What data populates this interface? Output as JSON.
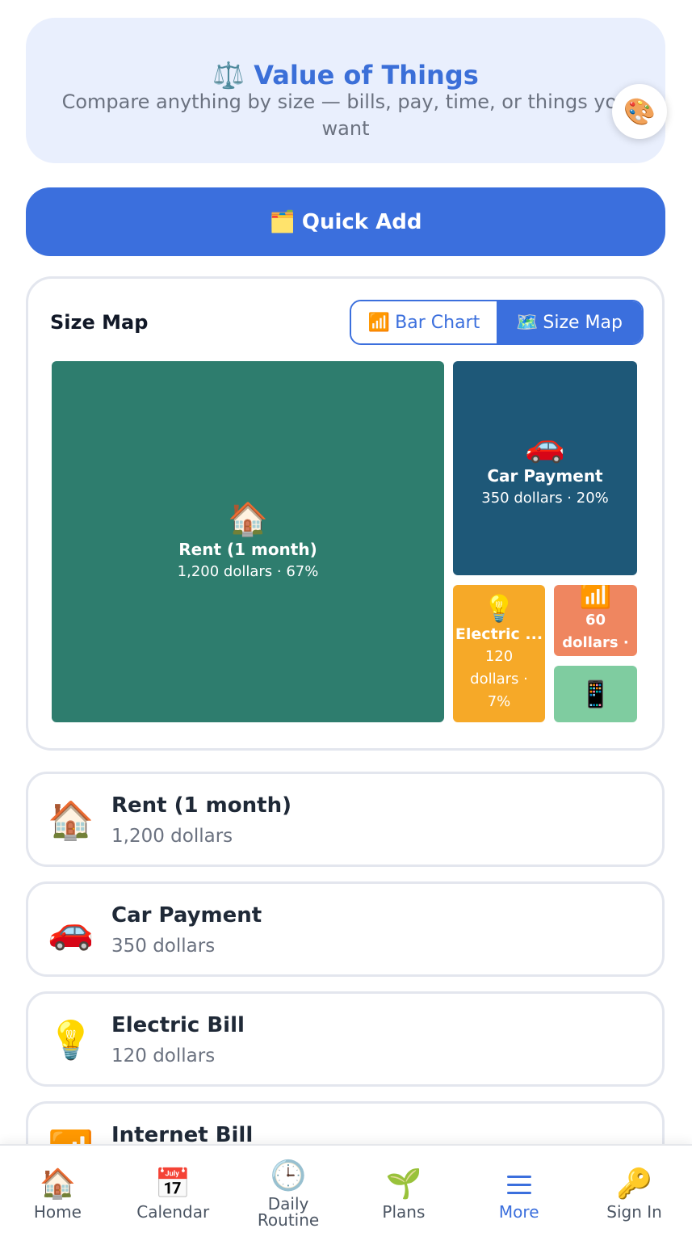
{
  "header": {
    "icon": "⚖️",
    "title": "Value of Things",
    "subtitle": "Compare anything by size — bills, pay, time, or things you want",
    "palette_icon": "🎨"
  },
  "quick_add": {
    "icon": "🗂️",
    "label": "Quick Add"
  },
  "size_map": {
    "title": "Size Map",
    "toggle": [
      {
        "icon": "📶",
        "label": "Bar Chart",
        "active": false
      },
      {
        "icon": "🗺️",
        "label": "Size Map",
        "active": true
      }
    ],
    "tiles": [
      {
        "icon": "🏠",
        "name": "Rent (1 month)",
        "value": "1,200 dollars · 67%",
        "color": "#2e7d6e"
      },
      {
        "icon": "🚗",
        "name": "Car Payment",
        "value": "350 dollars · 20%",
        "color": "#1e5878"
      },
      {
        "icon": "💡",
        "name": "Electric ...",
        "value_lines": [
          "120",
          "dollars ·",
          "7%"
        ],
        "color": "#f6a928"
      },
      {
        "icon": "📶",
        "value_lines": [
          "60",
          "dollars ·"
        ],
        "color": "#ef8660"
      },
      {
        "icon": "📱",
        "color": "#7fcca0"
      }
    ]
  },
  "items": [
    {
      "icon": "🏠",
      "name": "Rent (1 month)",
      "value": "1,200 dollars"
    },
    {
      "icon": "🚗",
      "name": "Car Payment",
      "value": "350 dollars"
    },
    {
      "icon": "💡",
      "name": "Electric Bill",
      "value": "120 dollars"
    },
    {
      "icon": "📶",
      "name": "Internet Bill",
      "value": ""
    }
  ],
  "nav": [
    {
      "icon": "🏠",
      "label": "Home"
    },
    {
      "icon": "📅",
      "label": "Calendar"
    },
    {
      "icon": "🕒",
      "label": "Daily Routine"
    },
    {
      "icon": "🌱",
      "label": "Plans"
    },
    {
      "icon": "hamburger-icon",
      "label": "More"
    },
    {
      "icon": "🔑",
      "label": "Sign In"
    }
  ]
}
